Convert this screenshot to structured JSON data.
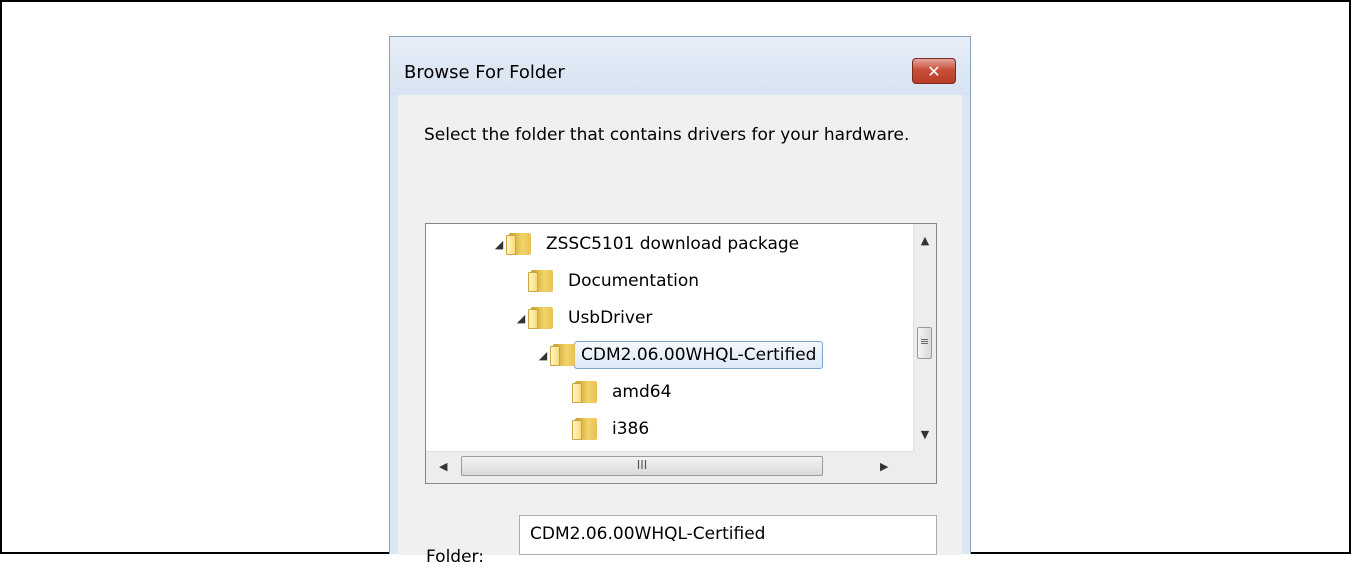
{
  "dialog": {
    "title": "Browse For Folder",
    "close_label": "✕",
    "instructions": "Select the folder that contains drivers for your hardware."
  },
  "tree": {
    "items": [
      {
        "label": "ZSSC5101 download package",
        "expander": "◢",
        "level": 0
      },
      {
        "label": "Documentation",
        "expander": "",
        "level": 1
      },
      {
        "label": "UsbDriver",
        "expander": "◢",
        "level": 1
      },
      {
        "label": "CDM2.06.00WHQL-Certified",
        "expander": "◢",
        "level": 2,
        "selected": true
      },
      {
        "label": "amd64",
        "expander": "",
        "level": 3
      },
      {
        "label": "i386",
        "expander": "",
        "level": 3
      }
    ],
    "vscroll_up": "▲",
    "vscroll_down": "▼",
    "vscroll_grip": "≡",
    "hscroll_left": "◀",
    "hscroll_right": "▶",
    "hscroll_grip": "III"
  },
  "folder": {
    "label": "Folder:",
    "value": "CDM2.06.00WHQL-Certified"
  }
}
